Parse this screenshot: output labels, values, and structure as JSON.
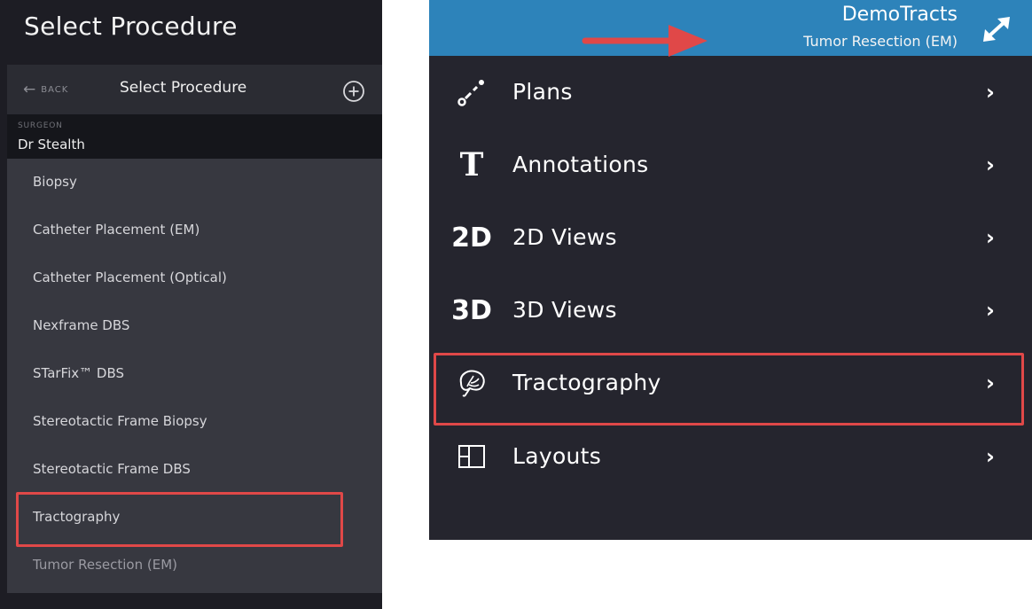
{
  "left": {
    "title": "Select Procedure",
    "header": {
      "back_label": "BACK",
      "title": "Select Procedure",
      "add_icon": "plus-circle-icon"
    },
    "surgeon": {
      "label": "SURGEON",
      "name": "Dr Stealth"
    },
    "procedures": [
      "Biopsy",
      "Catheter Placement (EM)",
      "Catheter Placement (Optical)",
      "Nexframe DBS",
      "STarFix™ DBS",
      "Stereotactic Frame Biopsy",
      "Stereotactic Frame DBS",
      "Tractography",
      "Tumor Resection (EM)"
    ],
    "highlighted_procedure": "Tractography"
  },
  "right": {
    "header": {
      "name": "DemoTracts",
      "procedure": "Tumor Resection (EM)",
      "expand_icon": "expand-arrows-icon",
      "color": "#2d83ba"
    },
    "menu": [
      {
        "icon": "plans-icon",
        "icon_text": "",
        "label": "Plans"
      },
      {
        "icon": "annotation-t-icon",
        "icon_text": "T",
        "label": "Annotations"
      },
      {
        "icon": "2d-icon",
        "icon_text": "2D",
        "label": "2D Views"
      },
      {
        "icon": "3d-icon",
        "icon_text": "3D",
        "label": "3D Views"
      },
      {
        "icon": "tractography-brain-icon",
        "icon_text": "",
        "label": "Tractography"
      },
      {
        "icon": "layouts-icon",
        "icon_text": "",
        "label": "Layouts"
      }
    ],
    "chevron": "›",
    "highlighted_item": "Tractography"
  },
  "colors": {
    "highlight": "#e04848",
    "arrow": "#e04848",
    "left_bg": "#1d1d24",
    "right_bg": "#25252e"
  }
}
